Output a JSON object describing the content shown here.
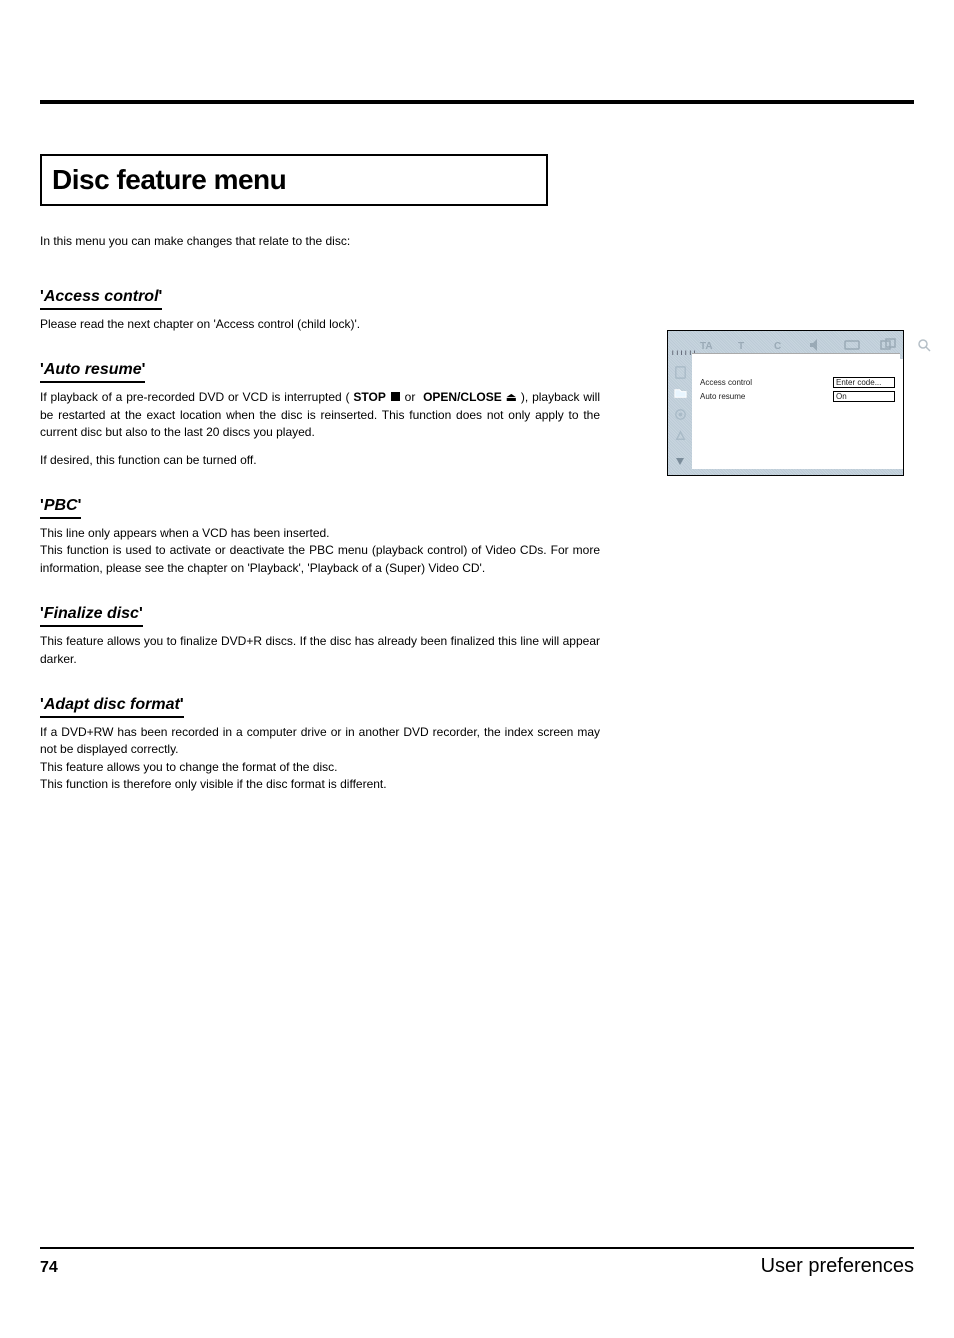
{
  "title": "Disc feature menu",
  "intro": "In this menu you can make changes that relate to the disc:",
  "sections": {
    "access": {
      "heading_term": "Access control",
      "body1": "Please read the next chapter on 'Access control (child lock)'."
    },
    "auto_resume": {
      "heading_term": "Auto resume",
      "body1_a": "If playback of a pre-recorded DVD or VCD is interrupted ( ",
      "stop": "STOP",
      "body1_b": " or ",
      "open": "OPEN/CLOSE",
      "body1_c": " ), playback will be restarted at the exact location when the disc is reinserted. This function does not only apply to the current disc but also to the last 20 discs you played.",
      "body2": "If desired, this function can be turned off."
    },
    "pbc": {
      "heading_term": "PBC",
      "body1": "This line only appears when a VCD has been inserted.",
      "body2": "This function is used to activate or deactivate the PBC menu (playback control) of Video CDs. For more information, please see the chapter on 'Playback', 'Playback of a (Super) Video CD'."
    },
    "finalize": {
      "heading_term": "Finalize disc",
      "body1": "This feature allows you to finalize DVD+R discs. If the disc has already been finalized this line will appear darker."
    },
    "adapt": {
      "heading_term": "Adapt disc format",
      "body1": "If a DVD+RW has been recorded in a computer drive or in another DVD recorder, the index screen may not be displayed correctly.",
      "body2": "This feature allows you to change the format of the disc.",
      "body3": "This function is therefore only visible if the disc format is different."
    }
  },
  "illus": {
    "top_labels": [
      "TA",
      "T",
      "C"
    ],
    "rows": [
      {
        "label": "Access control",
        "value": "Enter code...",
        "boxed": true
      },
      {
        "label": "Auto resume",
        "value": "On",
        "boxed": true
      }
    ]
  },
  "footer": {
    "page_num": "74",
    "section": "User preferences"
  }
}
